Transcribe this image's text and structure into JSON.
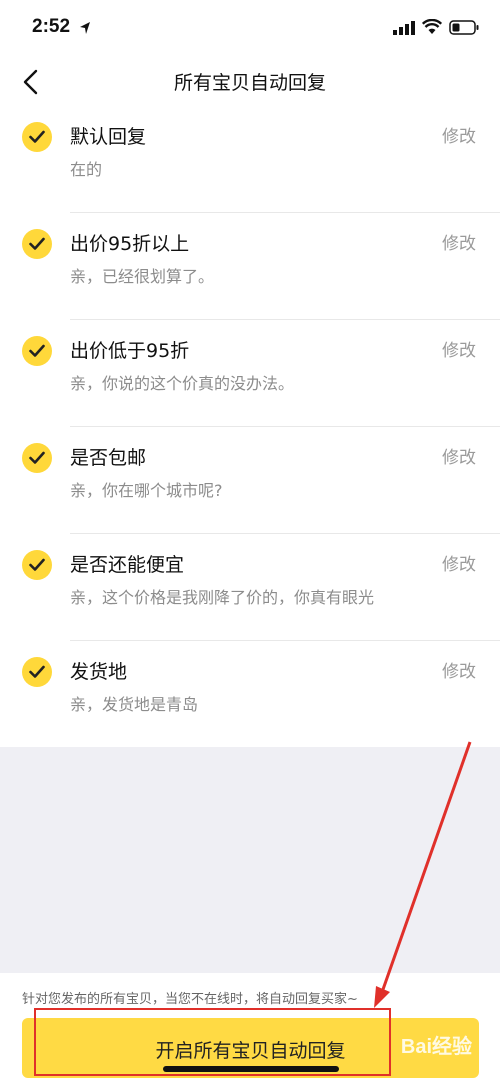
{
  "status": {
    "time": "2:52"
  },
  "nav": {
    "title": "所有宝贝自动回复"
  },
  "items": [
    {
      "title": "默认回复",
      "subtitle": "在的",
      "edit": "修改"
    },
    {
      "title": "出价95折以上",
      "subtitle": "亲，已经很划算了。",
      "edit": "修改"
    },
    {
      "title": "出价低于95折",
      "subtitle": "亲，你说的这个价真的没办法。",
      "edit": "修改"
    },
    {
      "title": "是否包邮",
      "subtitle": "亲，你在哪个城市呢?",
      "edit": "修改"
    },
    {
      "title": "是否还能便宜",
      "subtitle": "亲，这个价格是我刚降了价的，你真有眼光",
      "edit": "修改"
    },
    {
      "title": "发货地",
      "subtitle": "亲，发货地是青岛",
      "edit": "修改"
    }
  ],
  "footer": {
    "note": "针对您发布的所有宝贝，当您不在线时，将自动回复买家~",
    "button_label": "开启所有宝贝自动回复"
  },
  "watermark": "Bai经验",
  "colors": {
    "accent": "#ffda44",
    "annotation": "#e0302a"
  }
}
